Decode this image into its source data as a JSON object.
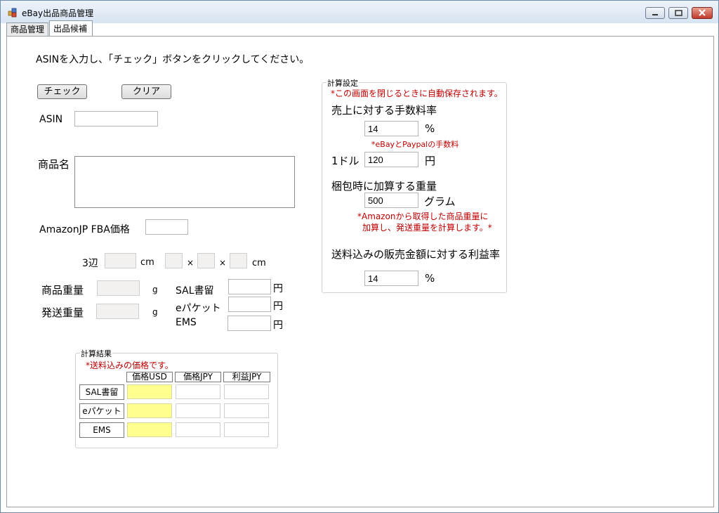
{
  "window": {
    "title": "eBay出品商品管理",
    "tabs": [
      {
        "label": "商品管理"
      },
      {
        "label": "出品候補"
      }
    ]
  },
  "form": {
    "instruction": "ASINを入力し、「チェック」ボタンをクリックしてください。",
    "check_button": "チェック",
    "clear_button": "クリア",
    "asin_label": "ASIN",
    "asin_value": "",
    "product_name_label": "商品名",
    "product_name_value": "",
    "amazon_price_label": "AmazonJP FBA価格",
    "amazon_price_value": "",
    "dimensions_label": "3辺",
    "cm1": "cm",
    "times1": "×",
    "times2": "×",
    "cm2": "cm",
    "weight_label": "商品重量",
    "weight_unit": "g",
    "shipping_weight_label": "発送重量",
    "shipping_weight_unit": "g",
    "sal_label": "SAL書留",
    "epacket_label": "eパケット",
    "ems_label": "EMS",
    "yen1": "円",
    "yen2": "円",
    "yen3": "円"
  },
  "results": {
    "title": "計算結果",
    "note": "*送料込みの価格です。",
    "columns": [
      "価格USD",
      "価格JPY",
      "利益JPY"
    ],
    "rows": [
      "SAL書留",
      "eパケット",
      "EMS"
    ]
  },
  "settings": {
    "title": "計算設定",
    "note": "*この画面を閉じるときに自動保存されます。",
    "fee_label": "売上に対する手数料率",
    "fee_value": "14",
    "fee_unit": "%",
    "fee_note": "*eBayとPaypalの手数料",
    "dollar_label": "1ドル",
    "dollar_value": "120",
    "dollar_unit": "円",
    "packing_label": "梱包時に加算する重量",
    "packing_value": "500",
    "packing_unit": "グラム",
    "packing_note1": "*Amazonから取得した商品重量に",
    "packing_note2": "加算し、発送重量を計算します。*",
    "profit_label": "送料込みの販売金額に対する利益率",
    "profit_value": "14",
    "profit_unit": "%"
  }
}
